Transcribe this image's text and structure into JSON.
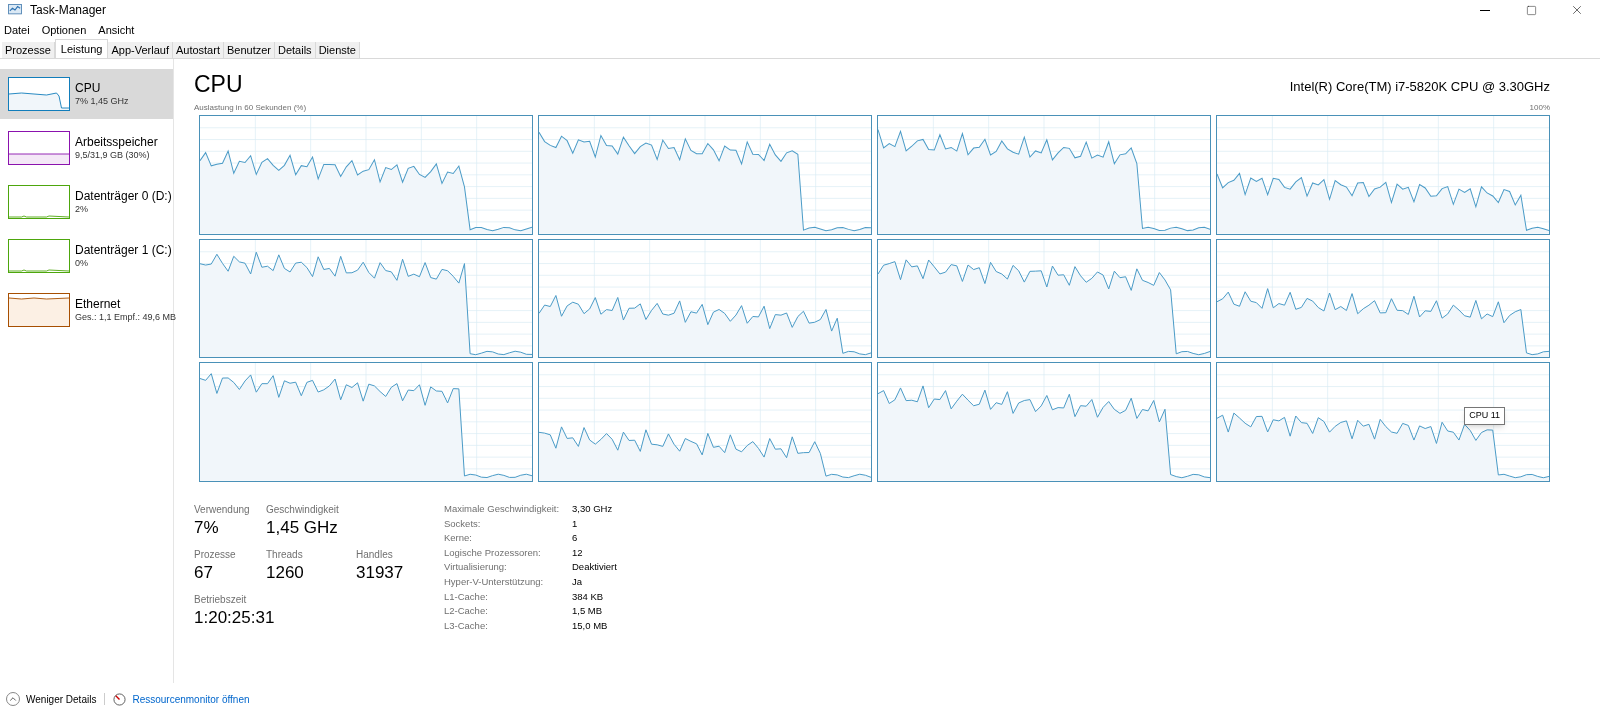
{
  "window": {
    "title": "Task-Manager"
  },
  "menu": [
    "Datei",
    "Optionen",
    "Ansicht"
  ],
  "tabs": [
    {
      "label": "Prozesse",
      "selected": false
    },
    {
      "label": "Leistung",
      "selected": true
    },
    {
      "label": "App-Verlauf",
      "selected": false
    },
    {
      "label": "Autostart",
      "selected": false
    },
    {
      "label": "Benutzer",
      "selected": false
    },
    {
      "label": "Details",
      "selected": false
    },
    {
      "label": "Dienste",
      "selected": false
    }
  ],
  "sidebar": {
    "items": [
      {
        "kind": "cpu",
        "title": "CPU",
        "subtitle": "7% 1,45 GHz",
        "color": "#117dbb",
        "selected": true
      },
      {
        "kind": "memory",
        "title": "Arbeitsspeicher",
        "subtitle": "9,5/31,9 GB (30%)",
        "color": "#8b12ae",
        "selected": false
      },
      {
        "kind": "disk",
        "title": "Datenträger 0 (D:)",
        "subtitle": "2%",
        "color": "#4da60c",
        "selected": false
      },
      {
        "kind": "disk",
        "title": "Datenträger 1 (C:)",
        "subtitle": "0%",
        "color": "#4da60c",
        "selected": false
      },
      {
        "kind": "network",
        "title": "Ethernet",
        "subtitle": "Ges.: 1,1 Empf.: 49,6 MB",
        "color": "#a74f01",
        "selected": false
      }
    ]
  },
  "main": {
    "title": "CPU",
    "model": "Intel(R) Core(TM) i7-5820K CPU @ 3.30GHz",
    "graph_caption": "Auslastung in 60 Sekunden (%)",
    "graph_max": "100%",
    "tooltip": "CPU 11",
    "stats": [
      {
        "label": "Verwendung",
        "value": "7%"
      },
      {
        "label": "Geschwindigkeit",
        "value": "1,45 GHz"
      },
      {
        "label": "Prozesse",
        "value": "67"
      },
      {
        "label": "Threads",
        "value": "1260"
      },
      {
        "label": "Handles",
        "value": "31937"
      },
      {
        "label": "Betriebszeit",
        "value": "1:20:25:31"
      }
    ],
    "details": [
      {
        "label": "Maximale Geschwindigkeit:",
        "value": "3,30 GHz"
      },
      {
        "label": "Sockets:",
        "value": "1"
      },
      {
        "label": "Kerne:",
        "value": "6"
      },
      {
        "label": "Logische Prozessoren:",
        "value": "12"
      },
      {
        "label": "Virtualisierung:",
        "value": "Deaktiviert"
      },
      {
        "label": "Hyper-V-Unterstützung:",
        "value": "Ja"
      },
      {
        "label": "L1-Cache:",
        "value": "384 KB"
      },
      {
        "label": "L2-Cache:",
        "value": "1,5 MB"
      },
      {
        "label": "L3-Cache:",
        "value": "15,0 MB"
      }
    ]
  },
  "footer": {
    "less_details": "Weniger Details",
    "resource_monitor": "Ressourcenmonitor öffnen"
  }
}
